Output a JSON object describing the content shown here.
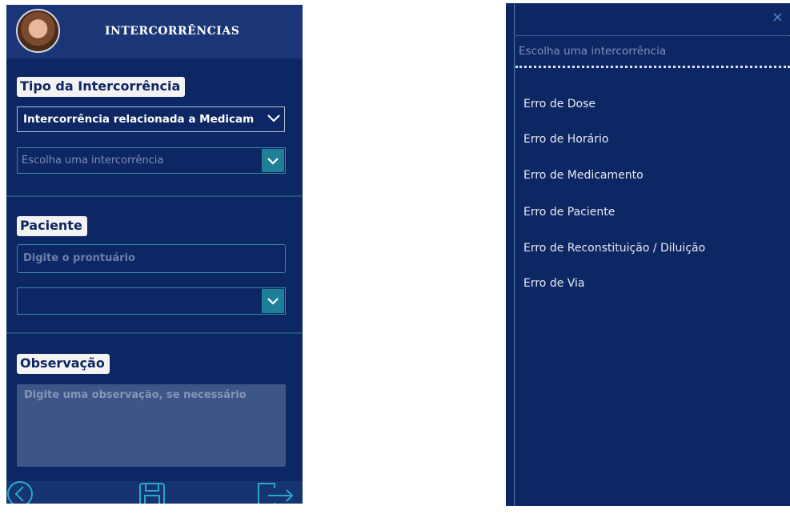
{
  "header": {
    "title": "INTERCORRÊNCIAS"
  },
  "tipo": {
    "label": "Tipo da Intercorrência",
    "selected": "Intercorrência relacionada a Medicam",
    "choice_placeholder": "Escolha uma intercorrência"
  },
  "paciente": {
    "label": "Paciente",
    "prontuario_placeholder": "Digite o prontuário",
    "select_value": ""
  },
  "observacao": {
    "label": "Observação",
    "placeholder": "Digite uma observação, se necessário"
  },
  "footer": {
    "icons": [
      "back-icon",
      "save-icon",
      "exit-icon"
    ]
  },
  "dropdown": {
    "close": "×",
    "search_placeholder": "Escolha uma intercorrência",
    "options": [
      "Erro de Dose",
      "Erro de Horário",
      "Erro de Medicamento",
      "Erro de Paciente",
      "Erro de Reconstituição / Diluição",
      "Erro de Via"
    ]
  },
  "colors": {
    "background": "#0d2664",
    "accent": "#1e7f98",
    "header": "#1a3676"
  }
}
